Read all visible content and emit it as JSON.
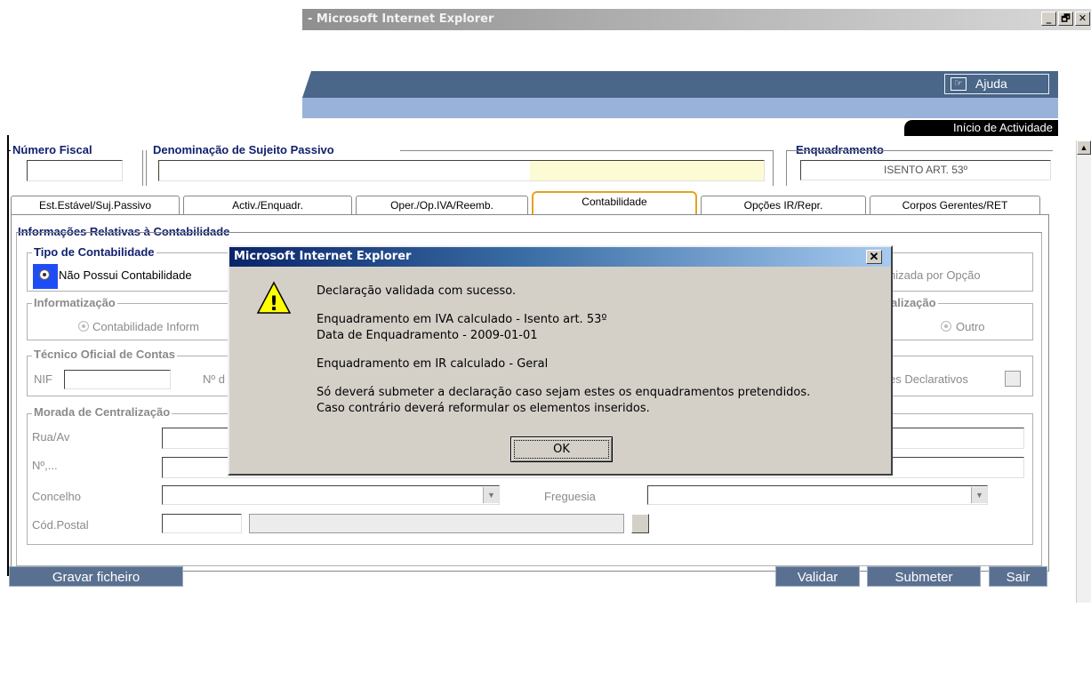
{
  "window": {
    "title": "- Microsoft Internet Explorer",
    "min_glyph": "_",
    "max_glyph": "🗗",
    "close_glyph": "✕"
  },
  "banner": {
    "help_label": "Ajuda",
    "help_icon_glyph": "☞",
    "activity_tab": "Início de Actividade"
  },
  "header": {
    "numero_fiscal_label": "Número Fiscal",
    "denominacao_label": "Denominação de Sujeito Passivo",
    "enquadramento_label": "Enquadramento",
    "enquadramento_value": "ISENTO ART. 53º"
  },
  "tabs": [
    {
      "label": "Est.Estável/Suj.Passivo"
    },
    {
      "label": "Activ./Enquadr."
    },
    {
      "label": "Oper./Op.IVA/Reemb."
    },
    {
      "label": "Contabilidade"
    },
    {
      "label": "Opções IR/Repr."
    },
    {
      "label": "Corpos Gerentes/RET"
    }
  ],
  "panel": {
    "informacoes_label": "Informações Relativas à Contabilidade",
    "tipo_label": "Tipo de Contabilidade",
    "nao_possui": "Não Possui Contabilidade",
    "organizada_opcao": "nizada por Opção",
    "informatizacao_label": "Informatização",
    "contab_informatizada": "Contabilidade Inform",
    "centralizacao_label": "alização",
    "outro": "Outro",
    "toc_label": "Técnico Oficial de Contas",
    "nif_label": "NIF",
    "no_label": "Nº d",
    "declarativos": "es Declarativos",
    "morada_label": "Morada de Centralização",
    "rua_label": "Rua/Av",
    "numero_label": "Nº,...",
    "concelho_label": "Concelho",
    "freguesia_label": "Freguesia",
    "cod_postal_label": "Cód.Postal"
  },
  "buttons": {
    "gravar": "Gravar ficheiro",
    "validar": "Validar",
    "submeter": "Submeter",
    "sair": "Sair"
  },
  "dialog": {
    "title": "Microsoft Internet Explorer",
    "close_glyph": "✕",
    "warning_glyph": "!",
    "line1": "Declaração validada com sucesso.",
    "line2": "Enquadramento em IVA calculado - Isento art. 53º",
    "line3": "Data de Enquadramento - 2009-01-01",
    "line4": "Enquadramento em IR calculado - Geral",
    "line5": "Só deverá submeter a declaração caso sejam estes os enquadramentos pretendidos.",
    "line6": "Caso contrário deverá reformular os elementos inseridos.",
    "ok_label": "OK"
  },
  "colors": {
    "banner_dark": "#4a6688",
    "banner_light": "#98b2da",
    "active_tab": "#e6a120",
    "label_blue": "#11216e",
    "highlight_field": "#fdfbd3"
  },
  "icons": {
    "scroll_up": "▲",
    "dropdown": "▼"
  }
}
